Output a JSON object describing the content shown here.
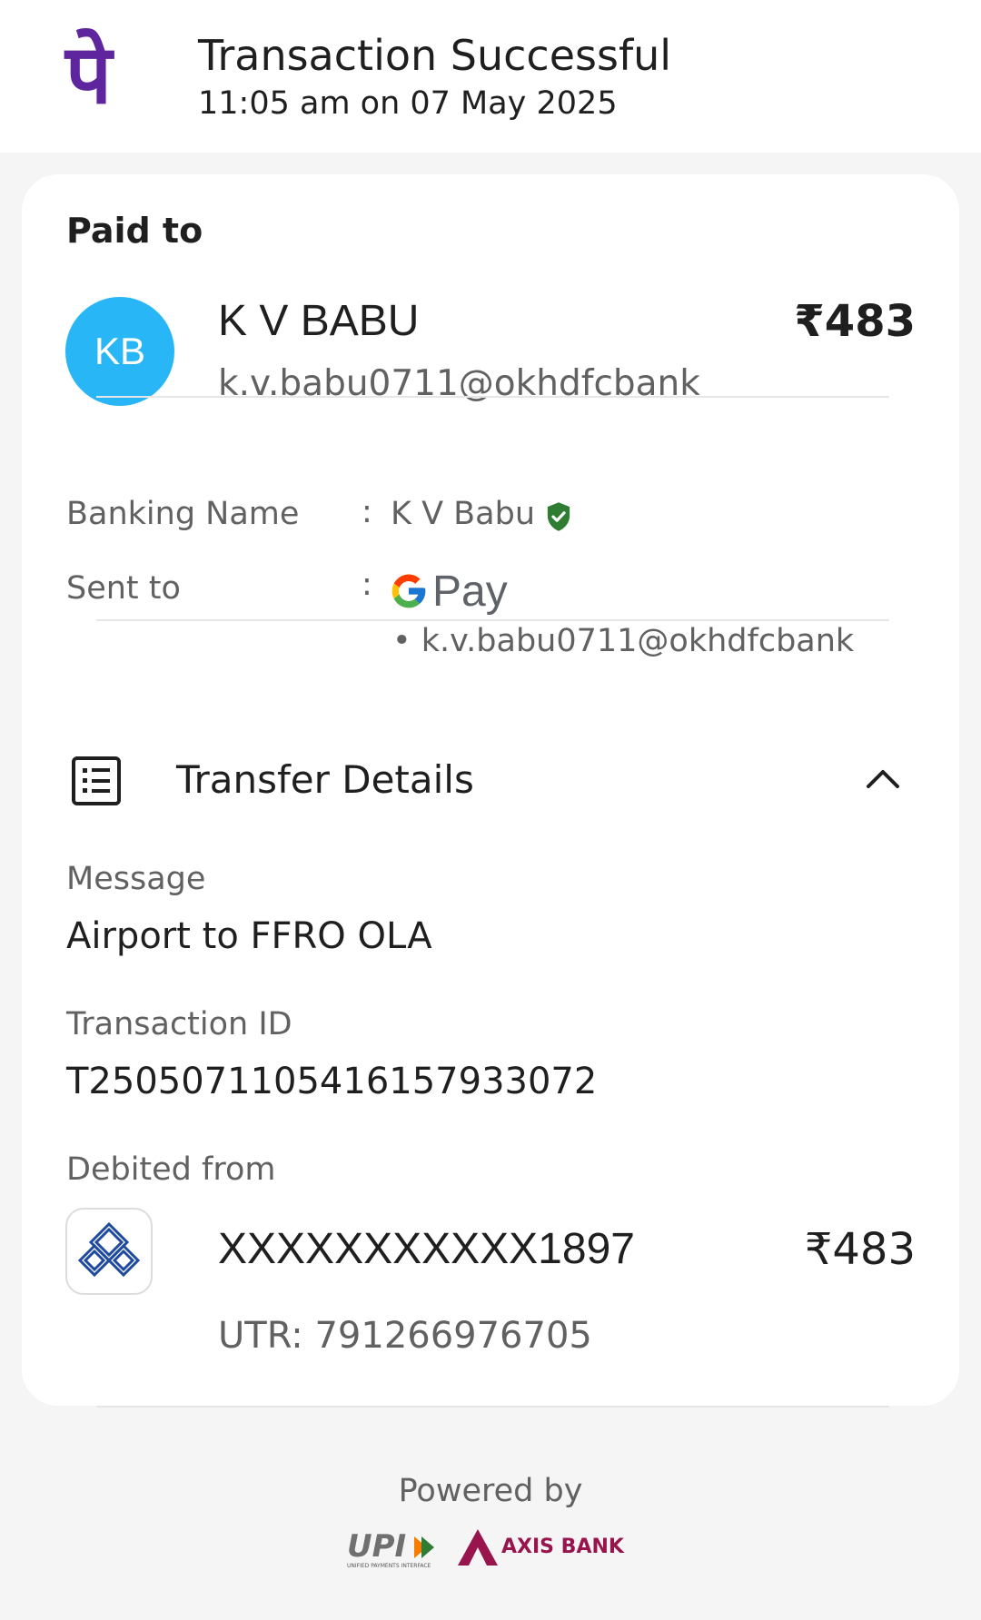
{
  "header": {
    "logo_glyph": "पे",
    "title": "Transaction Successful",
    "datetime": "11:05 am on 07 May 2025",
    "brand_color": "#5f259f"
  },
  "payee": {
    "section_label": "Paid to",
    "initials": "KB",
    "name": "K V BABU",
    "upi_id": "k.v.babu0711@okhdfcbank",
    "amount": "₹483",
    "avatar_color": "#29b6f6"
  },
  "details": {
    "banking_name_label": "Banking Name",
    "banking_name_value": "K V Babu",
    "verified_icon": "verified-shield-icon",
    "sent_to_label": "Sent to",
    "sent_to_app": "Pay",
    "sent_to_id": "• k.v.babu0711@okhdfcbank",
    "separator": ":"
  },
  "transfer": {
    "title": "Transfer Details",
    "message_label": "Message",
    "message_value": "Airport to FFRO OLA",
    "txn_id_label": "Transaction ID",
    "txn_id_value": "T2505071105416157933072",
    "debited_label": "Debited from",
    "account": "XXXXXXXXXXX1897",
    "debited_amount": "₹483",
    "utr": "UTR: 791266976705"
  },
  "footer": {
    "powered_by": "Powered by",
    "upi_text": "UPI",
    "upi_tagline": "UNIFIED PAYMENTS INTERFACE",
    "bank_text": "AXIS BANK"
  }
}
